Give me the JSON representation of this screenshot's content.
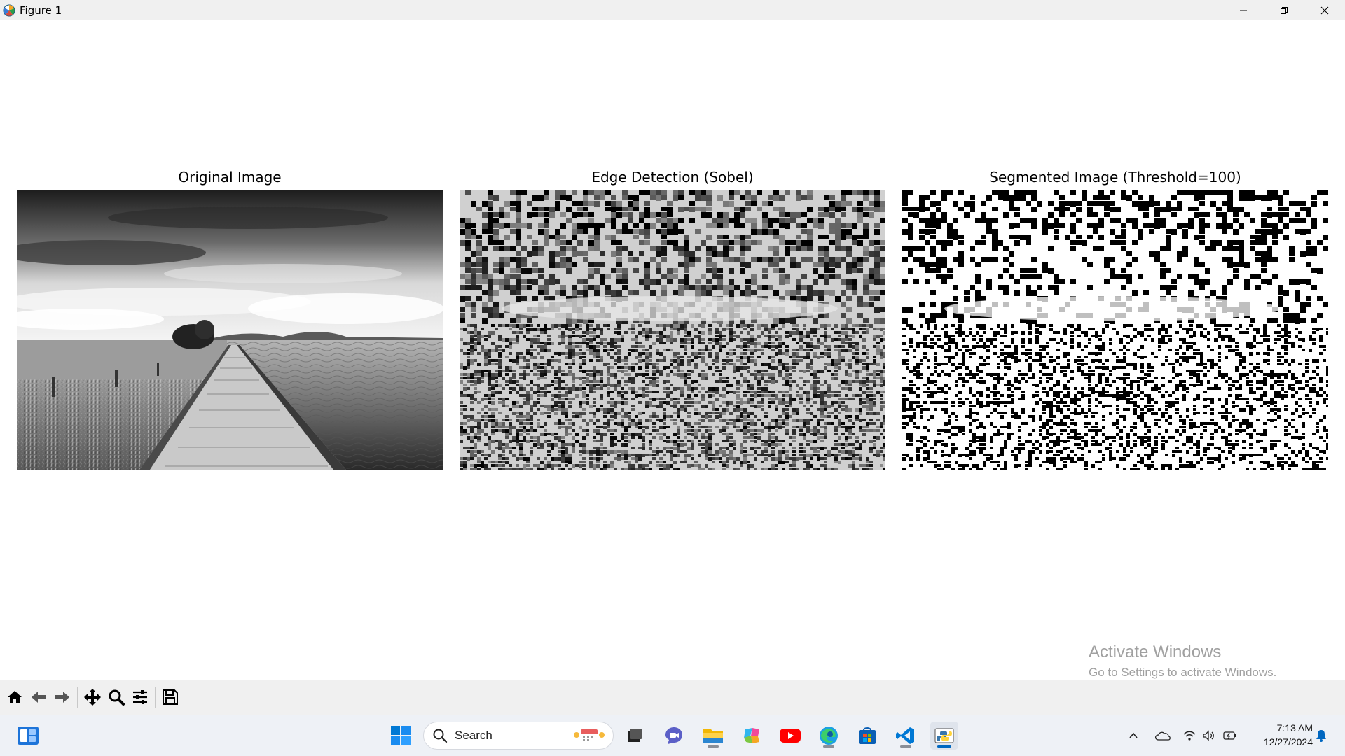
{
  "window": {
    "title": "Figure 1",
    "controls": [
      "minimize",
      "restore",
      "close"
    ]
  },
  "figure": {
    "panels": [
      {
        "title": "Original Image",
        "kind": "grayscale-photo"
      },
      {
        "title": "Edge Detection (Sobel)",
        "kind": "sobel-noise"
      },
      {
        "title": "Segmented Image (Threshold=100)",
        "kind": "binary-threshold"
      }
    ]
  },
  "watermark": {
    "title": "Activate Windows",
    "subtitle": "Go to Settings to activate Windows."
  },
  "toolbar": {
    "buttons": [
      "home-icon",
      "back-arrow-icon",
      "forward-arrow-icon",
      "pan-icon",
      "zoom-icon",
      "configure-subplots-icon",
      "save-icon"
    ]
  },
  "taskbar": {
    "search_label": "Search",
    "apps": [
      "widgets",
      "start",
      "task-view",
      "teams-chat",
      "file-explorer",
      "copilot",
      "youtube",
      "edge",
      "store",
      "vscode",
      "python"
    ],
    "clock_time": "7:13 AM",
    "clock_date": "12/27/2024"
  },
  "colors": {
    "titlebar": "#f0f0f0",
    "toolbar": "#f0f0f0",
    "taskbar": "#eef1f6",
    "watermark": "#a0a0a0",
    "accent": "#0067c0"
  }
}
